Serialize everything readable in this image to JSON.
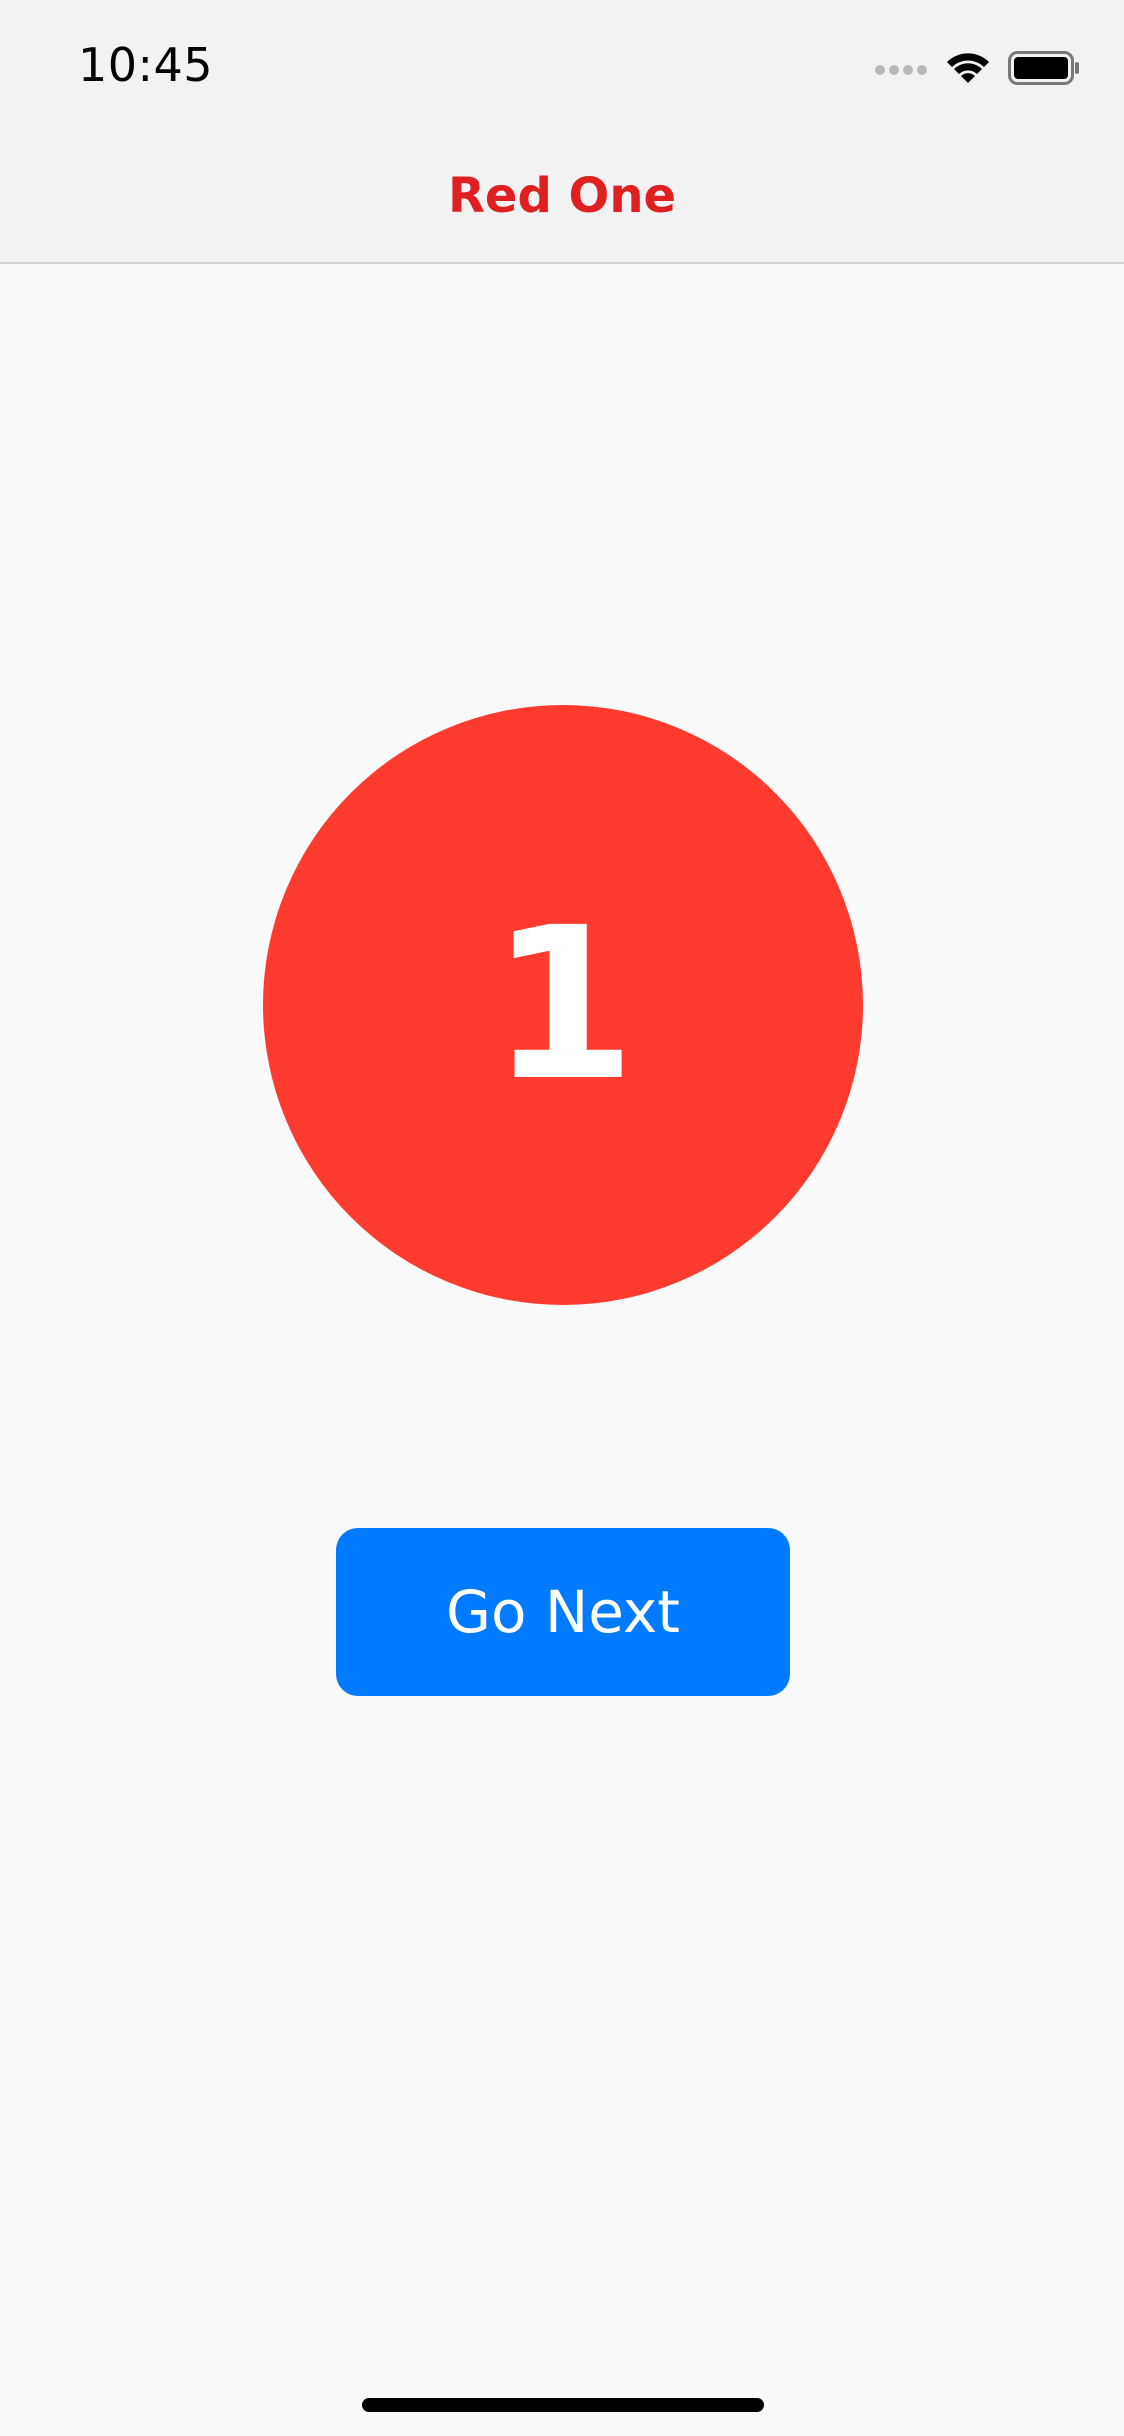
{
  "status_bar": {
    "time": "10:45",
    "icons": [
      "cellular-signal-icon",
      "wifi-icon",
      "battery-icon"
    ]
  },
  "nav_bar": {
    "title": "Red One",
    "title_color": "#e02020"
  },
  "content": {
    "badge": {
      "number": "1",
      "color": "#ff3b30"
    },
    "primary_button": {
      "label": "Go Next",
      "color": "#007aff"
    }
  }
}
